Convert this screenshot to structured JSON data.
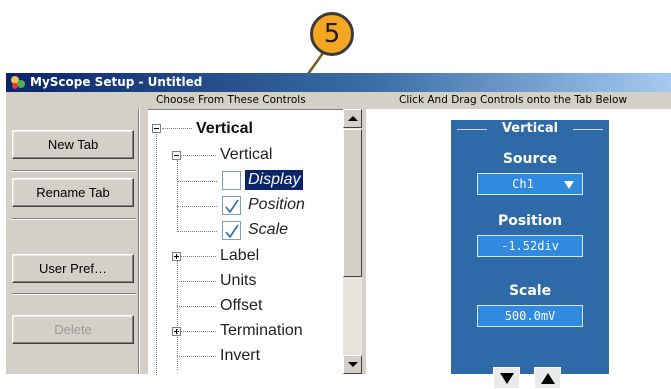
{
  "callout": {
    "number": "5"
  },
  "window": {
    "title": "MyScope Setup - Untitled"
  },
  "headers": {
    "choose": "Choose From These Controls",
    "drag": "Click And Drag Controls onto the Tab Below"
  },
  "buttons": {
    "new_tab": "New Tab",
    "rename_tab": "Rename Tab",
    "user_pref": "User Pref…",
    "delete": "Delete"
  },
  "tree": {
    "root": "Vertical",
    "group": "Vertical",
    "children": [
      {
        "label": "Display",
        "checked": false,
        "selected": true
      },
      {
        "label": "Position",
        "checked": true,
        "selected": false
      },
      {
        "label": "Scale",
        "checked": true,
        "selected": false
      }
    ],
    "items": [
      "Label",
      "Units",
      "Offset",
      "Termination",
      "Invert"
    ]
  },
  "panel": {
    "title": "Vertical",
    "source_label": "Source",
    "source_value": "Ch1",
    "position_label": "Position",
    "position_value": "-1.52div",
    "scale_label": "Scale",
    "scale_value": "500.0mV"
  },
  "colors": {
    "panel_blue": "#2f6aa8",
    "field_blue": "#2f8ae0",
    "callout_orange": "#f5a623",
    "title_bar": "#0a246a"
  }
}
